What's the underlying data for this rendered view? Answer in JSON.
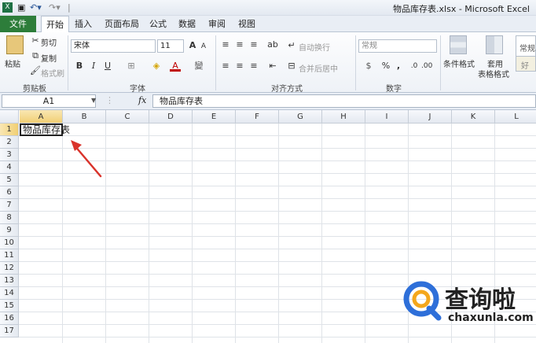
{
  "window": {
    "title": "物品库存表.xlsx - Microsoft Excel",
    "quick_access_separator": "|",
    "app_icon": "excel-icon"
  },
  "tabs": [
    "文件",
    "开始",
    "插入",
    "页面布局",
    "公式",
    "数据",
    "审阅",
    "视图"
  ],
  "ribbon": {
    "clipboard": {
      "paste": "粘贴",
      "cut": "剪切",
      "copy": "复制",
      "format_painter": "格式刷",
      "label": "剪贴板"
    },
    "font": {
      "family": "宋体",
      "size": "11",
      "bold": "B",
      "italic": "I",
      "underline": "U",
      "grow": "A",
      "shrink": "A",
      "font_color": "A",
      "label": "字体"
    },
    "alignment": {
      "wrap": "自动换行",
      "merge": "合并后居中",
      "label": "对齐方式"
    },
    "number": {
      "format": "常规",
      "percent": "%",
      "comma": ",",
      "label": "数字"
    },
    "styles": {
      "conditional": "条件格式",
      "table_format_1": "套用",
      "table_format_2": "表格格式",
      "style_normal": "常规",
      "style_good": "好"
    }
  },
  "formula_bar": {
    "name_box": "A1",
    "fx": "fx",
    "content": "物品库存表"
  },
  "sheet": {
    "columns": [
      "A",
      "B",
      "C",
      "D",
      "E",
      "F",
      "G",
      "H",
      "I",
      "J",
      "K",
      "L"
    ],
    "rows": [
      "1",
      "2",
      "3",
      "4",
      "5",
      "6",
      "7",
      "8",
      "9",
      "10",
      "11",
      "12",
      "13",
      "14",
      "15",
      "16",
      "17"
    ],
    "cell_A1": "物品库存表",
    "selected_cell": "A1"
  },
  "annotation": {
    "color": "#d9332b"
  },
  "watermark": {
    "brand": "查询啦",
    "url": "chaxunla.com",
    "color": "#f4a71d"
  }
}
